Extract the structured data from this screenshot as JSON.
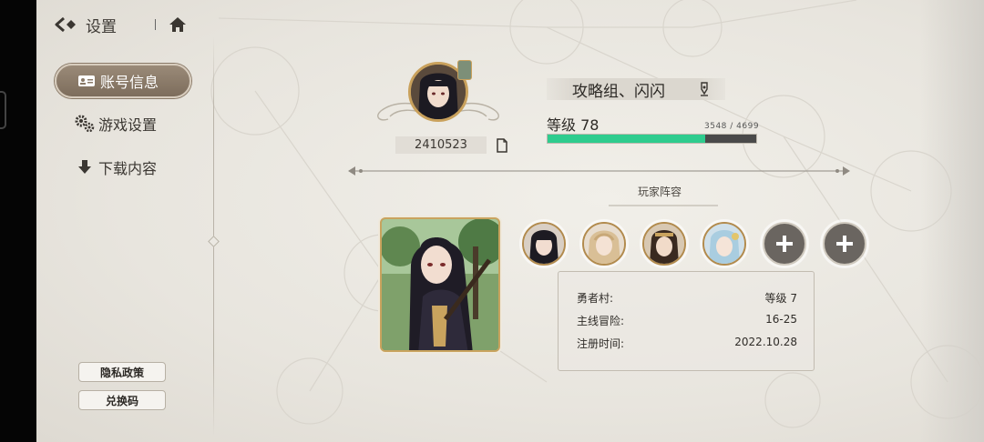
{
  "header": {
    "title": "设置"
  },
  "sidebar": {
    "items": [
      {
        "label": "账号信息",
        "icon": "id-card-icon",
        "active": true
      },
      {
        "label": "游戏设置",
        "icon": "gears-icon",
        "active": false
      },
      {
        "label": "下载内容",
        "icon": "download-icon",
        "active": false
      }
    ],
    "privacy_label": "隐私政策",
    "redeem_label": "兑换码"
  },
  "profile": {
    "uid": "2410523",
    "name": "攻略组、闪闪",
    "level_text": "等级 78",
    "exp_text": "3548 / 4699",
    "exp_current": 3548,
    "exp_max": 4699
  },
  "lineup": {
    "title": "玩家阵容",
    "members": [
      "heroine-portrait-1",
      "heroine-portrait-2",
      "heroine-portrait-3",
      "heroine-portrait-4"
    ],
    "empty_slots": 2
  },
  "info": {
    "rows": [
      {
        "label": "勇者村:",
        "value": "等级 7"
      },
      {
        "label": "主线冒险:",
        "value": "16-25"
      },
      {
        "label": "注册时间:",
        "value": "2022.10.28"
      }
    ]
  },
  "colors": {
    "accent_gold": "#c9a35e",
    "exp_green": "#2ecc8e",
    "active_tab": "#8a7a68"
  }
}
